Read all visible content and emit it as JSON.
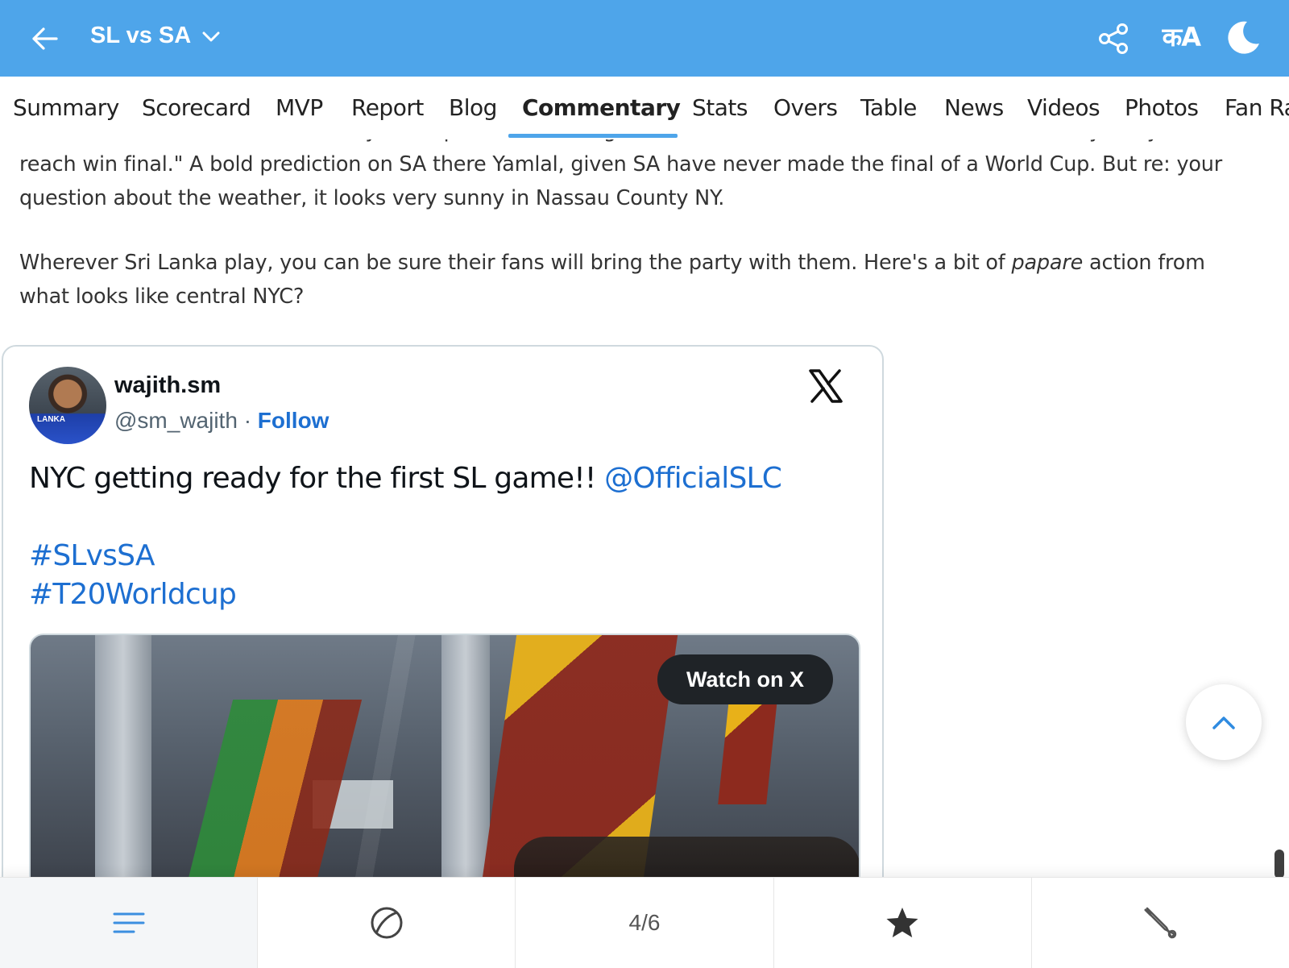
{
  "header": {
    "back_icon": "arrow-left-icon",
    "title": "SL vs SA",
    "dropdown_icon": "chevron-down-icon",
    "share_icon": "share-icon",
    "language_label": "कA",
    "theme_icon": "moon-icon",
    "bg_color": "#4ea5ea"
  },
  "tabs": [
    {
      "label": "Summary"
    },
    {
      "label": "Scorecard"
    },
    {
      "label": "MVP"
    },
    {
      "label": "Report"
    },
    {
      "label": "Blog"
    },
    {
      "label": "Commentary",
      "active": true
    },
    {
      "label": "Stats"
    },
    {
      "label": "Overs"
    },
    {
      "label": "Table"
    },
    {
      "label": "News"
    },
    {
      "label": "Videos"
    },
    {
      "label": "Photos"
    },
    {
      "label": "Fan Ra"
    }
  ],
  "commentary": {
    "para1_cut": "Yamlal: \"Hello from land of Himalayas \"Nepal\" ... its raining here, what about there ? ...........If SA win today, they will",
    "para1": "reach win final.\" A bold prediction on SA there Yamlal, given SA have never made the final of a World Cup. But re: your question about the weather, it looks very sunny in Nassau County NY.",
    "para2_before": "Wherever Sri Lanka play, you can be sure their fans will bring the party with them. Here's a bit of ",
    "para2_em": "papare",
    "para2_after": " action from what looks like central NYC?"
  },
  "tweet": {
    "display_name": "wajith.sm",
    "handle": "@sm_wajith",
    "separator": "·",
    "follow_label": "Follow",
    "logo_icon": "x-logo-icon",
    "text": "NYC getting ready for the first SL game!! ",
    "mention": "@OfficialSLC",
    "hashtags": [
      "#SLvsSA",
      "#T20Worldcup"
    ],
    "watch_label": "Watch on X",
    "link_color": "#1d6fd1"
  },
  "bottom_nav": {
    "items": [
      {
        "icon": "menu-lines-icon"
      },
      {
        "icon": "ball-icon"
      },
      {
        "label": "4/6"
      },
      {
        "icon": "star-icon"
      },
      {
        "icon": "cricket-bat-icon"
      }
    ]
  },
  "scroll_top_icon": "chevron-up-icon"
}
